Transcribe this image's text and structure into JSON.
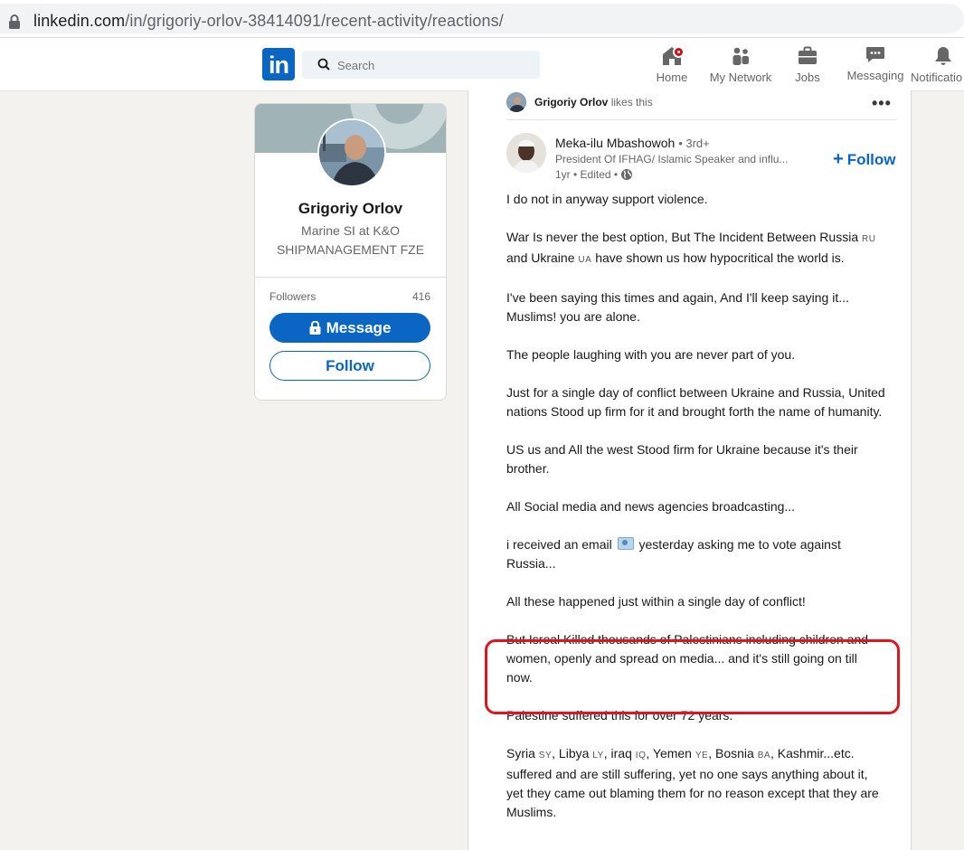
{
  "browser": {
    "url_host": "linkedin.com",
    "url_path": "/in/grigoriy-orlov-38414091/recent-activity/reactions/"
  },
  "nav": {
    "logo": "in",
    "search_placeholder": "Search",
    "items": [
      {
        "label": "Home",
        "icon": "home-icon"
      },
      {
        "label": "My Network",
        "icon": "people-icon"
      },
      {
        "label": "Jobs",
        "icon": "briefcase-icon"
      },
      {
        "label": "Messaging",
        "icon": "messaging-icon"
      },
      {
        "label": "Notificatio",
        "icon": "bell-icon"
      }
    ],
    "accent": "#0a66c2",
    "badge_color": "#cc1016"
  },
  "profile": {
    "name": "Grigoriy Orlov",
    "title": "Marine SI at K&O SHIPMANAGEMENT FZE",
    "followers_label": "Followers",
    "followers_count": "416",
    "message_button": "Message",
    "follow_button": "Follow"
  },
  "post": {
    "activity_actor": "Grigoriy Orlov",
    "activity_text": "likes this",
    "author_name": "Meka-ilu Mbashowoh",
    "author_degree": "• 3rd+",
    "author_headline": "President Of IFHAG/ Islamic Speaker and influ...",
    "timestamp": "1yr • Edited •",
    "follow_label": "Follow",
    "paragraphs": {
      "p1": "I do not in anyway support violence.",
      "p2a": "War Is never the best option, But The Incident Between Russia",
      "p2_flag_ru": "RU",
      "p2b": "and Ukraine",
      "p2_flag_ua": "UA",
      "p2c": "have shown us how hypocritical the world is.",
      "p3": "I've been saying this times and again, And I'll keep saying it... Muslims! you are alone.",
      "p4": "The people laughing with you are never part of you.",
      "p5": "Just for a single day of conflict between Ukraine and Russia, United nations Stood up firm for it and brought forth the name of humanity.",
      "p6": "US us and All the west Stood firm for Ukraine because it's their brother.",
      "p7": "All Social media and news agencies broadcasting...",
      "p8a": "i received an email",
      "p8b": "yesterday asking me to vote against Russia...",
      "p9": "All these happened just within a single day of conflict!",
      "p10": "But Isreal Killed thousands of Palestinians including children and women, openly and spread on media... and it's still going on till now.",
      "p11": "Palestine suffered this for over 72 years.",
      "p12_syria": "Syria",
      "p12_sy": "SY",
      "p12_libya": ", Libya",
      "p12_ly": "LY",
      "p12_iraq": ", iraq",
      "p12_iq": "IQ",
      "p12_yemen": ", Yemen",
      "p12_ye": "YE",
      "p12_bosnia": ", Bosnia",
      "p12_ba": "BA",
      "p12_rest": ", Kashmir...etc. suffered and are still suffering, yet no one says anything about it, yet they came out blaming them for no reason except that they are Muslims."
    },
    "highlight_color": "#e0161f"
  }
}
